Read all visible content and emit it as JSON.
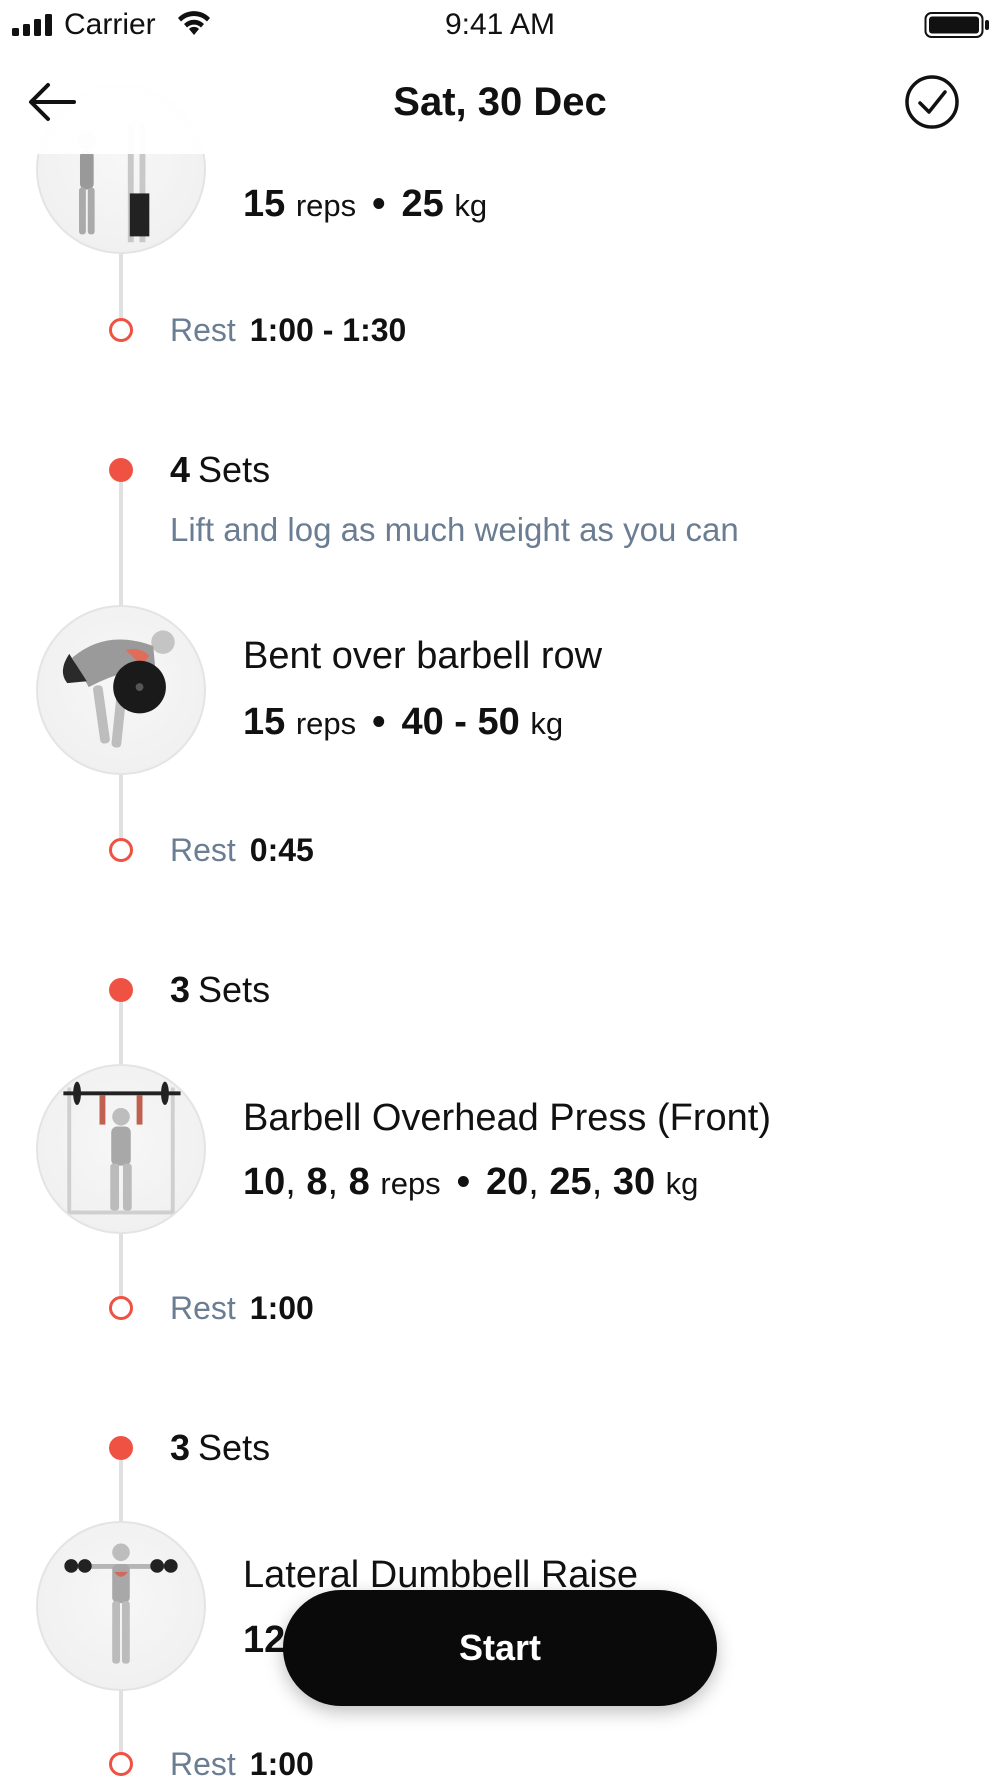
{
  "status_bar": {
    "carrier": "Carrier",
    "time": "9:41 AM"
  },
  "nav": {
    "title": "Sat, 30 Dec",
    "back_icon": "arrow-left-icon",
    "done_icon": "check-circle-icon"
  },
  "exercises": [
    {
      "name": "",
      "reps": "15",
      "reps_unit": "reps",
      "weight": "25",
      "weight_unit": "kg",
      "rest_label": "Rest",
      "rest_value": "1:00 - 1:30"
    },
    {
      "sets_count": "4",
      "sets_label": "Sets",
      "note": "Lift and log as much weight as you can",
      "name": "Bent over barbell row",
      "reps": "15",
      "reps_unit": "reps",
      "weight": "40 - 50",
      "weight_unit": "kg",
      "rest_label": "Rest",
      "rest_value": "0:45"
    },
    {
      "sets_count": "3",
      "sets_label": "Sets",
      "name": "Barbell Overhead Press (Front)",
      "reps": [
        "10",
        "8",
        "8"
      ],
      "reps_unit": "reps",
      "weight": [
        "20",
        "25",
        "30"
      ],
      "weight_unit": "kg",
      "rest_label": "Rest",
      "rest_value": "1:00"
    },
    {
      "sets_count": "3",
      "sets_label": "Sets",
      "name": "Lateral Dumbbell Raise",
      "reps_partial": "12,",
      "rest_label": "Rest",
      "rest_value": "1:00"
    }
  ],
  "start_button": {
    "label": "Start"
  },
  "colors": {
    "accent": "#ef5242",
    "muted_text": "#6b7d93",
    "button_bg": "#0a0a0a",
    "line": "#e0e0e0"
  }
}
